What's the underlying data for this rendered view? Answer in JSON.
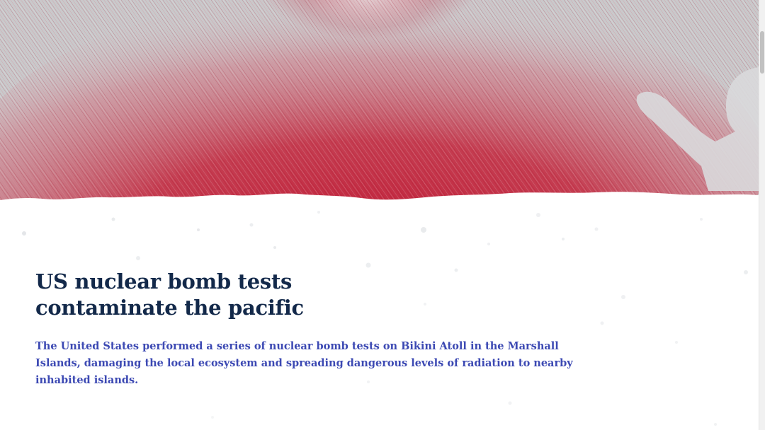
{
  "article": {
    "headline": "US nuclear bomb tests contaminate the pacific",
    "lede": "The United States performed a series of nuclear bomb tests on Bikini Atoll in the Marshall Islands, damaging the local ecosystem and spreading dangerous levels of radiation to nearby inhabited islands."
  },
  "hero": {
    "illustration": "mushroom-cloud-illustration",
    "figure": "person-silhouette-illustration"
  },
  "colors": {
    "headline": "#13294a",
    "lede": "#3c49b3",
    "cloud_red": "#c0132e",
    "hero_gray": "#c9c9cb"
  }
}
